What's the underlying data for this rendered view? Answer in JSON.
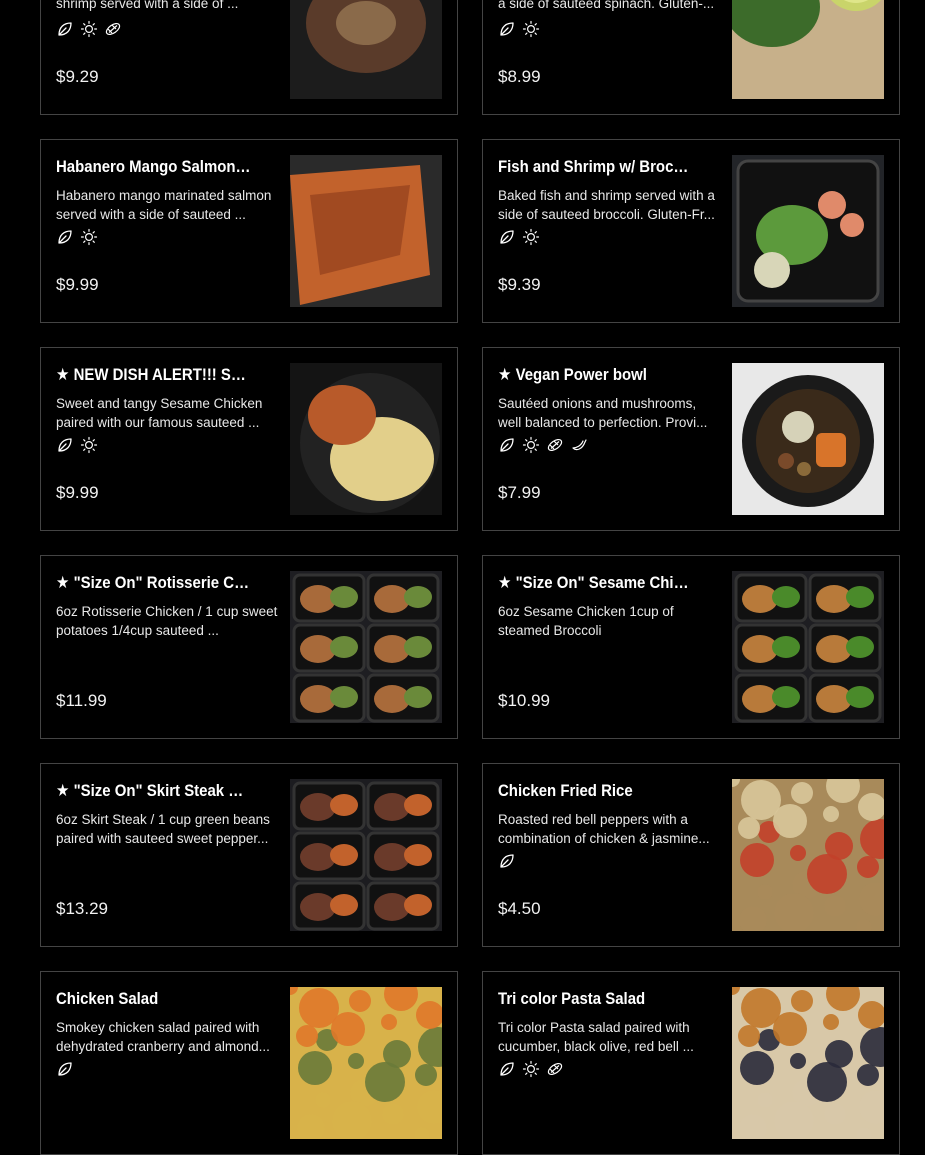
{
  "menu": {
    "items": [
      {
        "title": "",
        "description": "shrimp served with a side of ...",
        "tags": [
          "leaf-icon",
          "sun-icon",
          "bean-icon"
        ],
        "price": "$9.29",
        "image": "plated-dish-photo",
        "colors": [
          "#1c1c1c",
          "#5a3b2a",
          "#8a6a4a"
        ]
      },
      {
        "title": "",
        "description": "a side of sauteed spinach. Gluten-...",
        "tags": [
          "leaf-icon",
          "sun-icon"
        ],
        "price": "$8.99",
        "image": "spinach-lime-photo",
        "colors": [
          "#c7b08a",
          "#3c6b2a",
          "#c9d46a"
        ]
      },
      {
        "title": "Habanero Mango Salmon w/ ...",
        "description": "Habanero mango marinated salmon served with a side of sauteed ...",
        "tags": [
          "leaf-icon",
          "sun-icon"
        ],
        "price": "$9.99",
        "image": "salmon-photo",
        "colors": [
          "#c2622c",
          "#8a3a1a",
          "#2a2a2a"
        ]
      },
      {
        "title": "Fish and Shrimp w/ Broccoli",
        "description": "Baked fish and shrimp served with a side of sauteed broccoli. Gluten-Fr...",
        "tags": [
          "leaf-icon",
          "sun-icon"
        ],
        "price": "$9.39",
        "image": "fish-shrimp-broccoli-photo",
        "colors": [
          "#222428",
          "#e08a6a",
          "#5c9a3c"
        ]
      },
      {
        "title": "★ NEW DISH ALERT!!! Sesame ...",
        "description": "Sweet and tangy Sesame Chicken paired with our famous sauteed ...",
        "tags": [
          "leaf-icon",
          "sun-icon"
        ],
        "price": "$9.99",
        "image": "sesame-chicken-photo",
        "colors": [
          "#e2cf8a",
          "#b85a2a",
          "#141414"
        ]
      },
      {
        "title": "★ Vegan Power bowl",
        "description": "Sautéed onions and mushrooms, well balanced to perfection. Provi...",
        "tags": [
          "leaf-icon",
          "sun-icon",
          "bean-icon",
          "banana-icon"
        ],
        "price": "$7.99",
        "image": "vegan-bowl-photo",
        "colors": [
          "#e8e8e8",
          "#1a1a1a",
          "#d8742a"
        ]
      },
      {
        "title": "★ \"Size On\" Rotisserie Chicken",
        "description": "6oz Rotisserie Chicken / 1 cup sweet potatoes 1/4cup sauteed ...",
        "tags": [],
        "price": "$11.99",
        "image": "meal-prep-trays-photo",
        "colors": [
          "#1e1e22",
          "#a86a3a",
          "#6a8a3a"
        ]
      },
      {
        "title": "★ \"Size On\" Sesame Chicken",
        "description": "6oz Sesame Chicken 1cup of steamed Broccoli",
        "tags": [],
        "price": "$10.99",
        "image": "sesame-trays-photo",
        "colors": [
          "#1e1e22",
          "#b87a3a",
          "#4a8a2a"
        ]
      },
      {
        "title": "★ \"Size On\" Skirt Steak Beef Tips",
        "description": "6oz Skirt Steak / 1 cup green beans paired with sauteed sweet pepper...",
        "tags": [],
        "price": "$13.29",
        "image": "steak-trays-photo",
        "colors": [
          "#1c1c20",
          "#6a3a2a",
          "#c2622c"
        ]
      },
      {
        "title": "Chicken Fried Rice",
        "description": "Roasted red bell peppers with a combination of chicken & jasmine...",
        "tags": [
          "leaf-icon"
        ],
        "price": "$4.50",
        "image": "fried-rice-photo",
        "colors": [
          "#a88a5a",
          "#d8c79a",
          "#c2402a"
        ]
      },
      {
        "title": "Chicken Salad",
        "description": "Smokey chicken salad paired with dehydrated cranberry and almond...",
        "tags": [
          "leaf-icon"
        ],
        "price": "",
        "image": "chicken-salad-photo",
        "colors": [
          "#d8b24a",
          "#e0782a",
          "#6a7a3a"
        ]
      },
      {
        "title": "Tri color Pasta Salad",
        "description": "Tri color Pasta salad paired with cucumber, black olive, red bell ...",
        "tags": [
          "leaf-icon",
          "sun-icon",
          "bean-icon"
        ],
        "price": "",
        "image": "pasta-salad-photo",
        "colors": [
          "#d8c8a8",
          "#c2782a",
          "#2a2a3a"
        ]
      }
    ]
  }
}
